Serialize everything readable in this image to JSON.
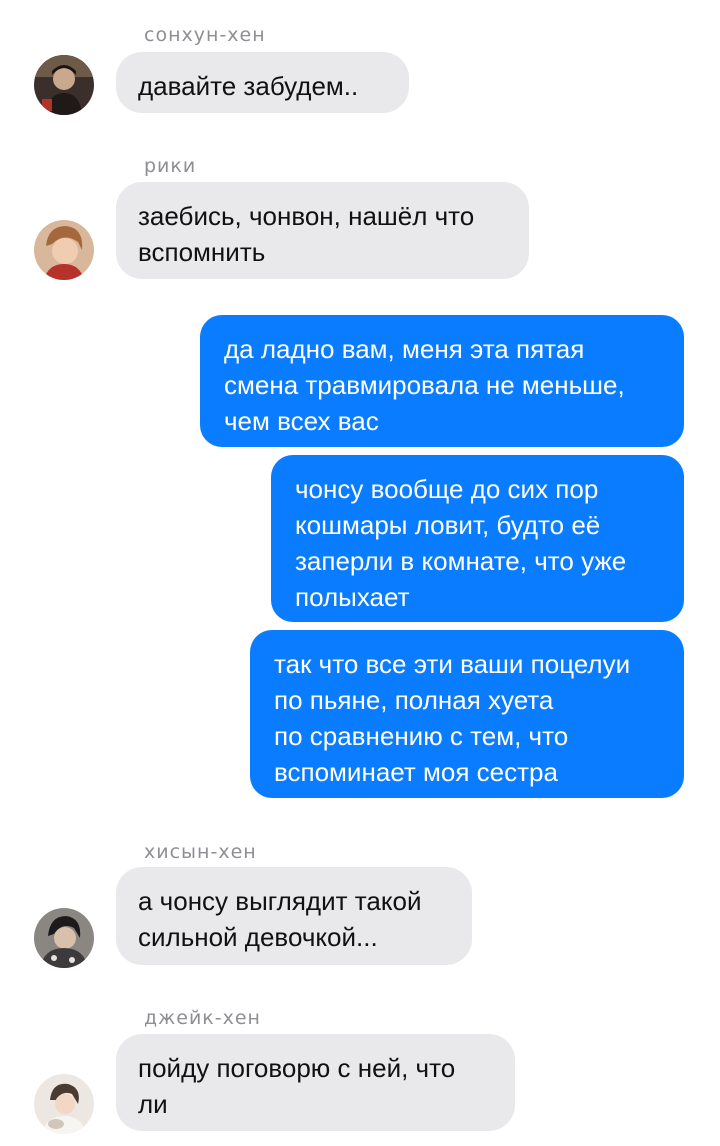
{
  "messages": [
    {
      "sender": "сонхун-хен",
      "avatar": "avatar-sonhoon",
      "lines": [
        "давайте забудем.."
      ]
    },
    {
      "sender": "рики",
      "avatar": "avatar-riki",
      "lines": [
        "заебись, чонвон, нашёл что",
        "вспомнить"
      ]
    },
    {
      "outgoing": true,
      "lines": [
        "да ладно вам, меня эта пятая",
        "смена травмировала не меньше,",
        "чем всех вас"
      ]
    },
    {
      "outgoing": true,
      "lines": [
        "чонсу вообще до сих пор",
        "кошмары ловит, будто её",
        "заперли в комнате, что уже",
        "полыхает"
      ]
    },
    {
      "outgoing": true,
      "lines": [
        "так что все эти ваши поцелуи",
        "по пьяне, полная хуета",
        "по сравнению с тем, что",
        "вспоминает моя сестра"
      ]
    },
    {
      "sender": "хисын-хен",
      "avatar": "avatar-heeseung",
      "lines": [
        "а чонсу выглядит такой",
        "сильной девочкой..."
      ]
    },
    {
      "sender": "джейк-хен",
      "avatar": "avatar-jake",
      "lines": [
        "пойду поговорю с ней, что",
        "ли"
      ]
    }
  ],
  "colors": {
    "outgoing_bubble": "#0a7cff",
    "incoming_bubble": "#e9e9eb",
    "sender_name": "#8e8e93"
  }
}
